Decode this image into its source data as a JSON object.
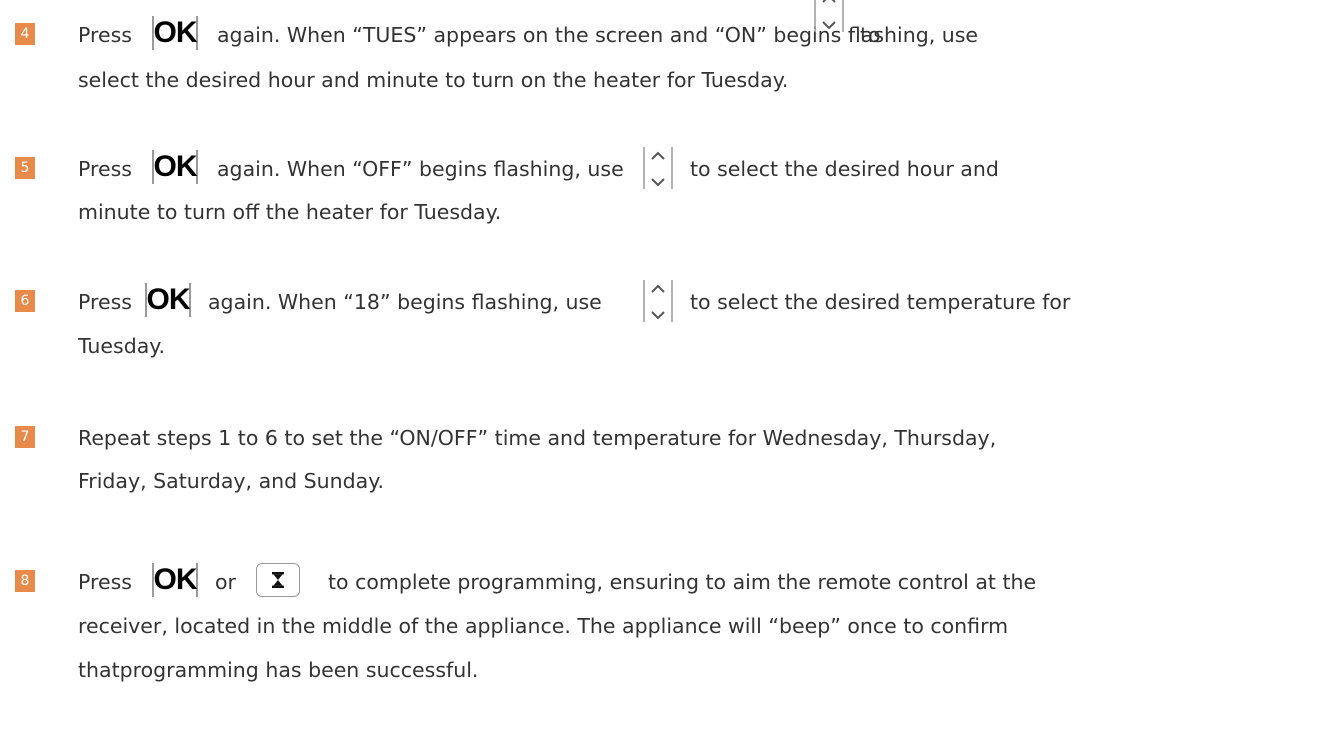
{
  "accent_color": "#e88a4a",
  "steps": [
    {
      "number": "4",
      "line1_a": "Press",
      "ok": "OK",
      "line1_b": "again. When “TUES” appears on the screen and “ON” begins flashing, use",
      "line1_c": "to",
      "line2": "select the desired hour and minute to turn on the heater for Tuesday."
    },
    {
      "number": "5",
      "line1_a": "Press",
      "ok": "OK",
      "line1_b": "again. When “OFF” begins flashing, use",
      "line1_c": "to select the desired hour and",
      "line2": "minute to turn off the heater for Tuesday."
    },
    {
      "number": "6",
      "line1_a": "Press",
      "ok": "OK",
      "line1_b": "again. When “18” begins flashing, use",
      "line1_c": "to select the desired temperature for",
      "line2": "Tuesday."
    },
    {
      "number": "7",
      "line1": "Repeat steps 1 to 6 to set the “ON/OFF” time and temperature for Wednesday, Thursday,",
      "line2": "Friday, Saturday, and Sunday."
    },
    {
      "number": "8",
      "line1_a": "Press",
      "ok": "OK",
      "line1_or": "or",
      "line1_b": "to complete programming, ensuring to aim the remote control at the",
      "line2": "receiver, located in the middle of the appliance. The appliance will “beep” once to confirm",
      "line3": "thatprogramming has been successful."
    }
  ],
  "icons": {
    "ok_button": "ok-button-icon",
    "updown": "up-down-arrows-icon",
    "timer": "hourglass-timer-icon"
  }
}
